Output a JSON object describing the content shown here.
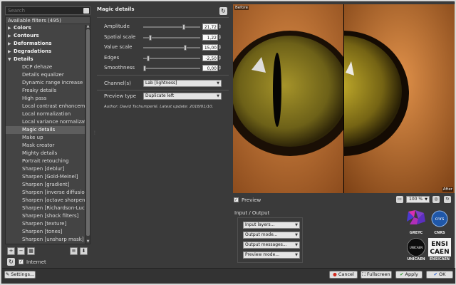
{
  "filters": {
    "search_placeholder": "Search",
    "header": "Available filters (495)",
    "categories": [
      {
        "label": "Colors"
      },
      {
        "label": "Contours"
      },
      {
        "label": "Deformations"
      },
      {
        "label": "Degradations"
      },
      {
        "label": "Details"
      }
    ],
    "detail_items": [
      "DCP dehaze",
      "Details equalizer",
      "Dynamic range increase",
      "Freaky details",
      "High pass",
      "Local contrast enhancemen",
      "Local normalization",
      "Local variance normalizatio",
      "Magic details",
      "Make up",
      "Mask creator",
      "Mighty details",
      "Portrait retouching",
      "Sharpen [deblur]",
      "Sharpen [Gold-Meinel]",
      "Sharpen [gradient]",
      "Sharpen [inverse diffusion]",
      "Sharpen [octave sharpening",
      "Sharpen [Richardson-Lucy]",
      "Sharpen [shock filters]",
      "Sharpen [texture]",
      "Sharpen [tones]",
      "Sharpen [unsharp mask]"
    ],
    "selected": "Magic details",
    "internet_label": "Internet"
  },
  "params": {
    "title": "Magic details",
    "sliders": [
      {
        "label": "Amplitude",
        "value": "21,72",
        "fraction": 0.72
      },
      {
        "label": "Spatial scale",
        "value": "1,22",
        "fraction": 0.1
      },
      {
        "label": "Value scale",
        "value": "15,00",
        "fraction": 0.75
      },
      {
        "label": "Edges",
        "value": "-2,50",
        "fraction": 0.06
      },
      {
        "label": "Smoothness",
        "value": "0,00",
        "fraction": 0.0
      }
    ],
    "channels_label": "Channel(s)",
    "channels_value": "Lab [lightness]",
    "preview_type_label": "Preview type",
    "preview_type_value": "Duplicate left",
    "author": "Author: David Tschumperlé. Latest update: 2018/01/10."
  },
  "preview": {
    "before_label": "Before",
    "after_label": "After",
    "preview_checkbox": "Preview",
    "zoom": "100 %"
  },
  "io": {
    "title": "Input / Output",
    "selects": [
      "Input layers...",
      "Output mode...",
      "Output messages...",
      "Preview mode..."
    ]
  },
  "logos": [
    "GREYC",
    "CNRS",
    "UNICAEN",
    "ENSICAEN"
  ],
  "logo_marks": {
    "cnrs": "cnrs",
    "ensi": "ENSI",
    "caen": "CAEN",
    "unicaen": "UNICAEN"
  },
  "bottom": {
    "settings": "Settings...",
    "cancel": "Cancel",
    "fullscreen": "Fullscreen",
    "apply": "Apply",
    "ok": "OK"
  },
  "icons": {
    "refresh": "refresh-icon",
    "clear": "clear-search-icon",
    "settings": "settings-icon"
  },
  "colors": {
    "cancel_red": "#d22a1e",
    "apply_green": "#2a9a2a",
    "ok_blue": "#2a5fd2"
  }
}
